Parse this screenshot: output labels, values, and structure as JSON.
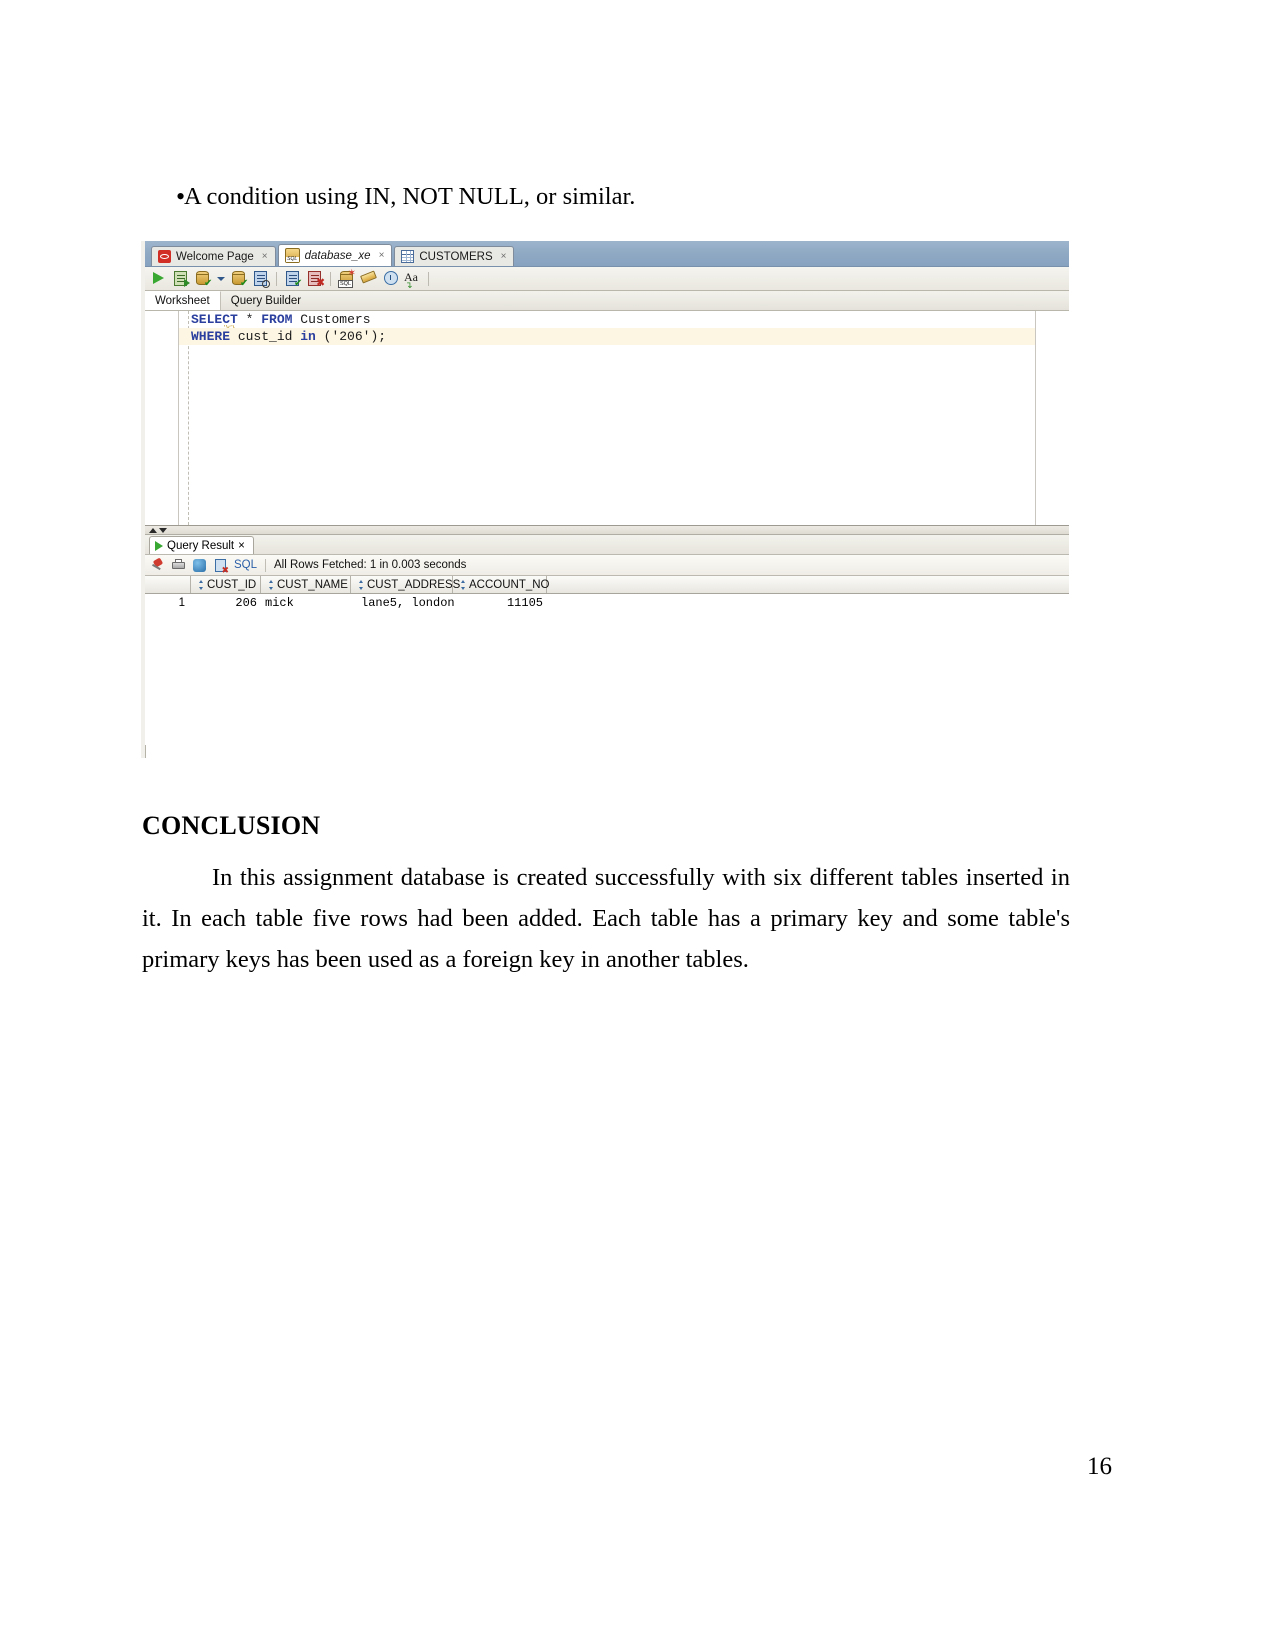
{
  "document": {
    "bullet": {
      "marker": "•",
      "text": "A condition using IN, NOT NULL, or similar."
    },
    "conclusion_heading": "CONCLUSION",
    "conclusion_body": "In this assignment database is created successfully with six different tables inserted in it. In each table five rows had been added. Each table has a primary key and  some table's primary keys has been used as a foreign key in another tables.",
    "page_number": "16"
  },
  "sqldeveloper": {
    "editor_tabs": [
      {
        "label": "Welcome Page",
        "icon": "oracle-icon",
        "close": "×",
        "active": false
      },
      {
        "label": "database_xe",
        "icon": "sql-connection-icon",
        "close": "×",
        "active": true
      },
      {
        "label": "CUSTOMERS",
        "icon": "table-icon",
        "close": "×",
        "active": false
      }
    ],
    "toolbar": {
      "buttons": [
        {
          "name": "run-statement-button",
          "tooltip": "Run Statement"
        },
        {
          "name": "run-script-button",
          "tooltip": "Run Script"
        },
        {
          "name": "commit-button",
          "tooltip": "Commit"
        },
        {
          "name": "dropdown-arrow-button",
          "tooltip": "More"
        },
        {
          "name": "rollback-button",
          "tooltip": "Rollback"
        },
        {
          "name": "explain-plan-button",
          "tooltip": "Explain Plan"
        },
        {
          "name": "autotrace-button",
          "tooltip": "Autotrace"
        },
        {
          "name": "clear-button",
          "tooltip": "Clear"
        },
        {
          "name": "sql-history-button",
          "tooltip": "SQL History"
        },
        {
          "name": "format-eraser-button",
          "tooltip": "Clear Worksheet"
        },
        {
          "name": "recent-button",
          "tooltip": "Recent"
        },
        {
          "name": "format-text-button",
          "tooltip": "Aa"
        }
      ]
    },
    "worksheet_tabs": [
      {
        "label": "Worksheet",
        "active": true
      },
      {
        "label": "Query Builder",
        "active": false
      }
    ],
    "code_lines": [
      {
        "highlight": false,
        "tokens": [
          {
            "t": "SELECT",
            "k": "kw"
          },
          {
            "t": " ",
            "k": "plain-txt"
          },
          {
            "t": "*",
            "k": "op"
          },
          {
            "t": " ",
            "k": "plain-txt"
          },
          {
            "t": "FROM",
            "k": "kw"
          },
          {
            "t": " ",
            "k": "plain-txt"
          },
          {
            "t": "Customers",
            "k": "plain-txt"
          }
        ]
      },
      {
        "highlight": true,
        "tokens": [
          {
            "t": "WHERE",
            "k": "kw"
          },
          {
            "t": " cust_id ",
            "k": "plain-txt"
          },
          {
            "t": "in",
            "k": "kw"
          },
          {
            "t": " ('206');",
            "k": "plain-txt"
          }
        ]
      }
    ],
    "result_tab": {
      "label": "Query Result",
      "close": "×"
    },
    "result_toolbar": {
      "sql_label": "SQL",
      "separator": "|",
      "status": "All Rows Fetched: 1 in 0.003 seconds"
    },
    "result_grid": {
      "columns": [
        "CUST_ID",
        "CUST_NAME",
        "CUST_ADDRESS",
        "ACCOUNT_NO"
      ],
      "rows": [
        {
          "row_number": "1",
          "cells": [
            "206",
            "mick",
            "lane5, london",
            "11105"
          ]
        }
      ]
    }
  }
}
